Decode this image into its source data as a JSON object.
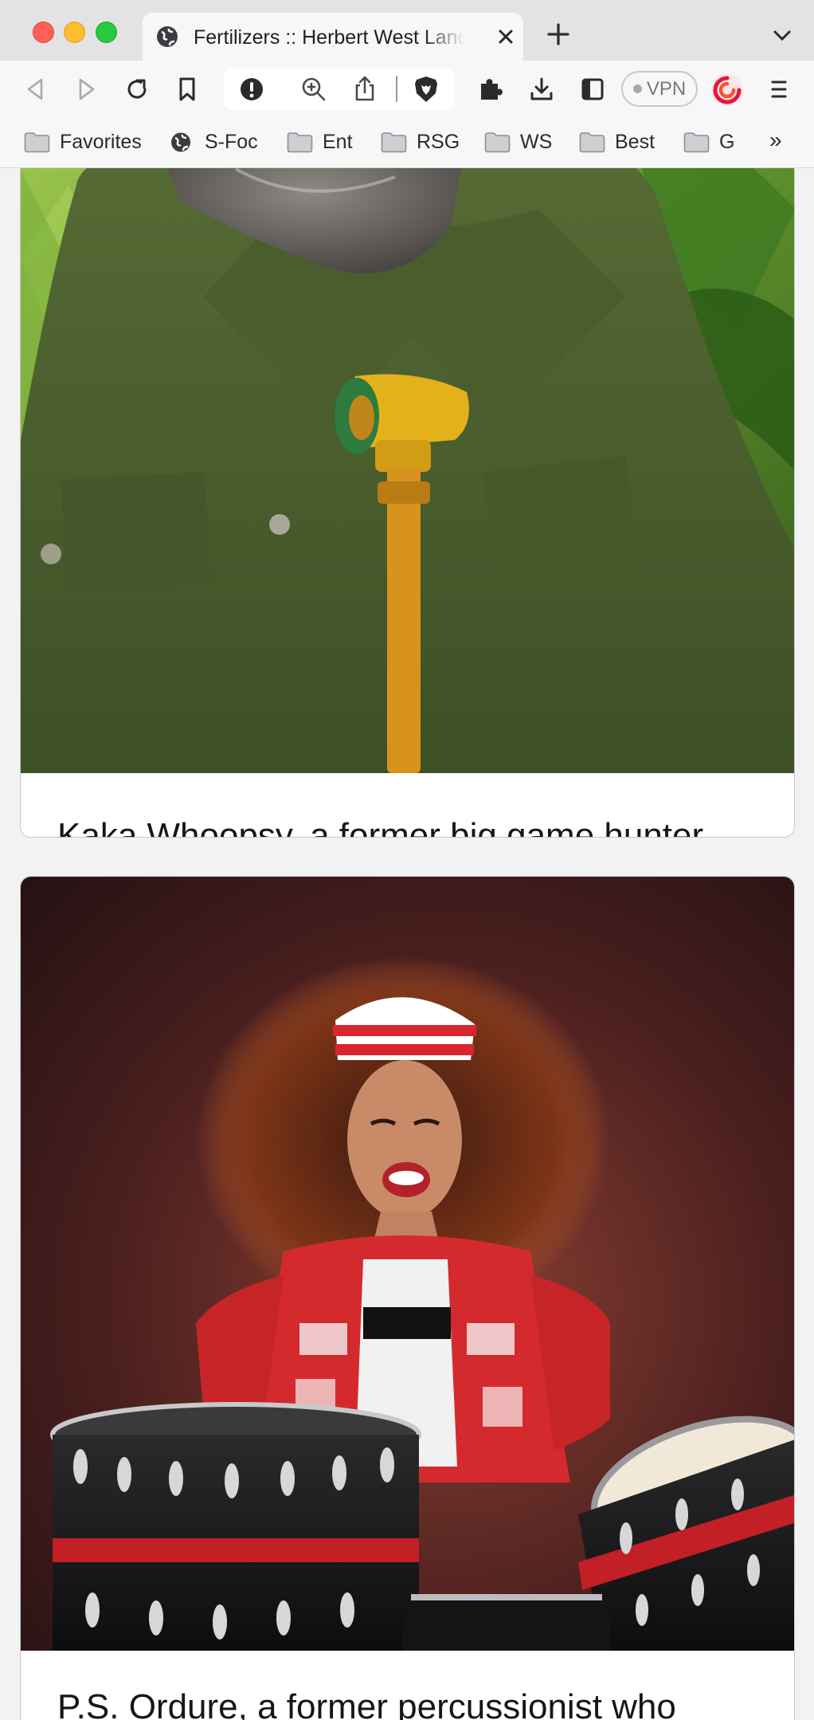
{
  "browser": {
    "tab": {
      "title": "Fertilizers :: Herbert West Landscaping"
    },
    "vpn_label": "VPN",
    "bookmarks": [
      {
        "label": "Favorites",
        "icon": "folder-icon"
      },
      {
        "label": "S-Foc",
        "icon": "globe-icon"
      },
      {
        "label": "Ent",
        "icon": "folder-icon"
      },
      {
        "label": "RSG",
        "icon": "folder-icon"
      },
      {
        "label": "WS",
        "icon": "folder-icon"
      },
      {
        "label": "Best",
        "icon": "folder-icon"
      },
      {
        "label": "G",
        "icon": "folder-icon"
      }
    ],
    "bookmarks_overflow": "»"
  },
  "cards": [
    {
      "image": "jungle-hunter-portrait",
      "caption": "Kaka Whoopsy, a former big game hunter who was famous for always staying on the spoor"
    },
    {
      "image": "drummer-portrait",
      "caption": "P.S. Ordure, a former percussionist who"
    }
  ],
  "colors": {
    "accent_brave": "#fb542b",
    "tab_bg": "#f7f7f8",
    "strip_bg": "#e3e3e6"
  }
}
